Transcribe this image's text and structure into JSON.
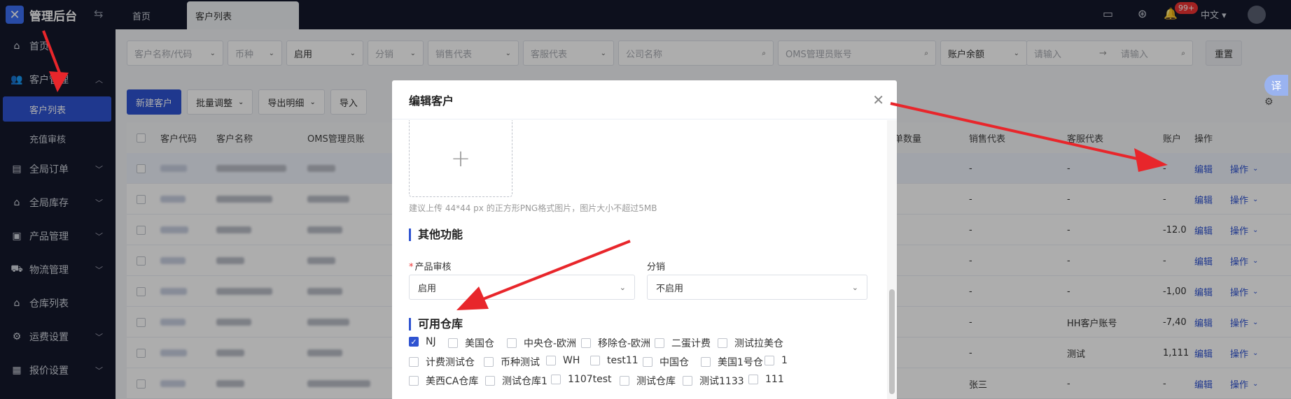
{
  "app": {
    "title": "管理后台"
  },
  "sidebar": {
    "items": [
      {
        "label": "首页",
        "icon": "home-icon"
      },
      {
        "label": "客户管理",
        "icon": "users-icon",
        "expanded": true
      },
      {
        "label": "全局订单",
        "icon": "order-icon"
      },
      {
        "label": "全局库存",
        "icon": "warehouse-icon"
      },
      {
        "label": "产品管理",
        "icon": "box-icon"
      },
      {
        "label": "物流管理",
        "icon": "truck-icon"
      },
      {
        "label": "仓库列表",
        "icon": "store-icon"
      },
      {
        "label": "运费设置",
        "icon": "freight-icon"
      },
      {
        "label": "报价设置",
        "icon": "quote-icon"
      }
    ],
    "sub_items": [
      {
        "label": "客户列表",
        "active": true
      },
      {
        "label": "充值审核"
      }
    ]
  },
  "topbar": {
    "tabs": [
      "首页",
      "客户列表"
    ],
    "notification_count": "99+",
    "language": "中文"
  },
  "filters": {
    "customer_name_code": "客户名称/代码",
    "currency": "币种",
    "status": "启用",
    "distribution": "分销",
    "sales_rep": "销售代表",
    "service_rep": "客服代表",
    "company_name": "公司名称",
    "oms_account": "OMS管理员账号",
    "balance_field": "账户余额",
    "range_from": "请输入",
    "range_to": "请输入",
    "reset": "重置"
  },
  "actions": {
    "new_customer": "新建客户",
    "batch_adjust": "批量调整",
    "export_detail": "导出明细",
    "import": "导入"
  },
  "table": {
    "headers": [
      "客户代码",
      "客户名称",
      "OMS管理员账",
      "单数量",
      "销售代表",
      "客服代表",
      "账户",
      "操作"
    ],
    "rows": [
      {
        "sales": "-",
        "service": "-",
        "balance": "-",
        "edit": "编辑",
        "op": "操作"
      },
      {
        "sales": "-",
        "service": "-",
        "balance": "-",
        "edit": "编辑",
        "op": "操作"
      },
      {
        "sales": "-",
        "service": "-",
        "balance": "-12.0",
        "edit": "编辑",
        "op": "操作"
      },
      {
        "sales": "-",
        "service": "-",
        "balance": "-",
        "edit": "编辑",
        "op": "操作"
      },
      {
        "sales": "-",
        "service": "-",
        "balance": "-1,00",
        "edit": "编辑",
        "op": "操作"
      },
      {
        "sales": "-",
        "service": "HH客户账号",
        "balance": "-7,40",
        "edit": "编辑",
        "op": "操作"
      },
      {
        "sales": "-",
        "service": "测试",
        "balance": "1,111",
        "edit": "编辑",
        "op": "操作"
      },
      {
        "sales": "张三",
        "service": "-",
        "balance": "-",
        "edit": "编辑",
        "op": "操作"
      }
    ]
  },
  "float_button": "译",
  "modal": {
    "title": "编辑客户",
    "upload_hint": "建议上传 44*44 px 的正方形PNG格式图片，图片大小不超过5MB",
    "section_other": "其他功能",
    "product_review_label": "产品审核",
    "product_review_value": "启用",
    "distribution_label": "分销",
    "distribution_value": "不启用",
    "section_warehouse": "可用仓库",
    "warehouses": [
      {
        "label": "NJ",
        "checked": true
      },
      {
        "label": "美国仓",
        "checked": false
      },
      {
        "label": "中央仓-欧洲",
        "checked": false
      },
      {
        "label": "移除仓-欧洲",
        "checked": false
      },
      {
        "label": "二蛋计费",
        "checked": false
      },
      {
        "label": "测试拉美仓",
        "checked": false
      },
      {
        "label": "计费测试仓",
        "checked": false
      },
      {
        "label": "币种测试",
        "checked": false
      },
      {
        "label": "WH",
        "checked": false
      },
      {
        "label": "test11",
        "checked": false
      },
      {
        "label": "中国仓",
        "checked": false
      },
      {
        "label": "美国1号仓",
        "checked": false
      },
      {
        "label": "1",
        "checked": false
      },
      {
        "label": "美西CA仓库",
        "checked": false
      },
      {
        "label": "测试仓库1",
        "checked": false
      },
      {
        "label": "1107test",
        "checked": false
      },
      {
        "label": "测试仓库",
        "checked": false
      },
      {
        "label": "测试1133",
        "checked": false
      },
      {
        "label": "111",
        "checked": false
      }
    ]
  },
  "colors": {
    "primary": "#2f53d1",
    "sidebar_bg": "#14192b",
    "annotation_arrow": "#e8262b"
  }
}
